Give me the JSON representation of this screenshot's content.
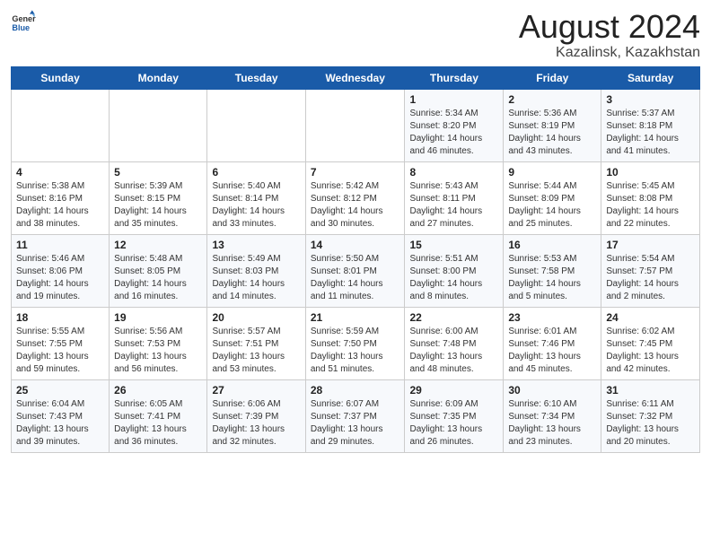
{
  "header": {
    "logo_text1": "General",
    "logo_text2": "Blue",
    "title": "August 2024",
    "subtitle": "Kazalinsk, Kazakhstan"
  },
  "weekdays": [
    "Sunday",
    "Monday",
    "Tuesday",
    "Wednesday",
    "Thursday",
    "Friday",
    "Saturday"
  ],
  "weeks": [
    [
      {
        "day": "",
        "info": ""
      },
      {
        "day": "",
        "info": ""
      },
      {
        "day": "",
        "info": ""
      },
      {
        "day": "",
        "info": ""
      },
      {
        "day": "1",
        "info": "Sunrise: 5:34 AM\nSunset: 8:20 PM\nDaylight: 14 hours\nand 46 minutes."
      },
      {
        "day": "2",
        "info": "Sunrise: 5:36 AM\nSunset: 8:19 PM\nDaylight: 14 hours\nand 43 minutes."
      },
      {
        "day": "3",
        "info": "Sunrise: 5:37 AM\nSunset: 8:18 PM\nDaylight: 14 hours\nand 41 minutes."
      }
    ],
    [
      {
        "day": "4",
        "info": "Sunrise: 5:38 AM\nSunset: 8:16 PM\nDaylight: 14 hours\nand 38 minutes."
      },
      {
        "day": "5",
        "info": "Sunrise: 5:39 AM\nSunset: 8:15 PM\nDaylight: 14 hours\nand 35 minutes."
      },
      {
        "day": "6",
        "info": "Sunrise: 5:40 AM\nSunset: 8:14 PM\nDaylight: 14 hours\nand 33 minutes."
      },
      {
        "day": "7",
        "info": "Sunrise: 5:42 AM\nSunset: 8:12 PM\nDaylight: 14 hours\nand 30 minutes."
      },
      {
        "day": "8",
        "info": "Sunrise: 5:43 AM\nSunset: 8:11 PM\nDaylight: 14 hours\nand 27 minutes."
      },
      {
        "day": "9",
        "info": "Sunrise: 5:44 AM\nSunset: 8:09 PM\nDaylight: 14 hours\nand 25 minutes."
      },
      {
        "day": "10",
        "info": "Sunrise: 5:45 AM\nSunset: 8:08 PM\nDaylight: 14 hours\nand 22 minutes."
      }
    ],
    [
      {
        "day": "11",
        "info": "Sunrise: 5:46 AM\nSunset: 8:06 PM\nDaylight: 14 hours\nand 19 minutes."
      },
      {
        "day": "12",
        "info": "Sunrise: 5:48 AM\nSunset: 8:05 PM\nDaylight: 14 hours\nand 16 minutes."
      },
      {
        "day": "13",
        "info": "Sunrise: 5:49 AM\nSunset: 8:03 PM\nDaylight: 14 hours\nand 14 minutes."
      },
      {
        "day": "14",
        "info": "Sunrise: 5:50 AM\nSunset: 8:01 PM\nDaylight: 14 hours\nand 11 minutes."
      },
      {
        "day": "15",
        "info": "Sunrise: 5:51 AM\nSunset: 8:00 PM\nDaylight: 14 hours\nand 8 minutes."
      },
      {
        "day": "16",
        "info": "Sunrise: 5:53 AM\nSunset: 7:58 PM\nDaylight: 14 hours\nand 5 minutes."
      },
      {
        "day": "17",
        "info": "Sunrise: 5:54 AM\nSunset: 7:57 PM\nDaylight: 14 hours\nand 2 minutes."
      }
    ],
    [
      {
        "day": "18",
        "info": "Sunrise: 5:55 AM\nSunset: 7:55 PM\nDaylight: 13 hours\nand 59 minutes."
      },
      {
        "day": "19",
        "info": "Sunrise: 5:56 AM\nSunset: 7:53 PM\nDaylight: 13 hours\nand 56 minutes."
      },
      {
        "day": "20",
        "info": "Sunrise: 5:57 AM\nSunset: 7:51 PM\nDaylight: 13 hours\nand 53 minutes."
      },
      {
        "day": "21",
        "info": "Sunrise: 5:59 AM\nSunset: 7:50 PM\nDaylight: 13 hours\nand 51 minutes."
      },
      {
        "day": "22",
        "info": "Sunrise: 6:00 AM\nSunset: 7:48 PM\nDaylight: 13 hours\nand 48 minutes."
      },
      {
        "day": "23",
        "info": "Sunrise: 6:01 AM\nSunset: 7:46 PM\nDaylight: 13 hours\nand 45 minutes."
      },
      {
        "day": "24",
        "info": "Sunrise: 6:02 AM\nSunset: 7:45 PM\nDaylight: 13 hours\nand 42 minutes."
      }
    ],
    [
      {
        "day": "25",
        "info": "Sunrise: 6:04 AM\nSunset: 7:43 PM\nDaylight: 13 hours\nand 39 minutes."
      },
      {
        "day": "26",
        "info": "Sunrise: 6:05 AM\nSunset: 7:41 PM\nDaylight: 13 hours\nand 36 minutes."
      },
      {
        "day": "27",
        "info": "Sunrise: 6:06 AM\nSunset: 7:39 PM\nDaylight: 13 hours\nand 32 minutes."
      },
      {
        "day": "28",
        "info": "Sunrise: 6:07 AM\nSunset: 7:37 PM\nDaylight: 13 hours\nand 29 minutes."
      },
      {
        "day": "29",
        "info": "Sunrise: 6:09 AM\nSunset: 7:35 PM\nDaylight: 13 hours\nand 26 minutes."
      },
      {
        "day": "30",
        "info": "Sunrise: 6:10 AM\nSunset: 7:34 PM\nDaylight: 13 hours\nand 23 minutes."
      },
      {
        "day": "31",
        "info": "Sunrise: 6:11 AM\nSunset: 7:32 PM\nDaylight: 13 hours\nand 20 minutes."
      }
    ]
  ]
}
